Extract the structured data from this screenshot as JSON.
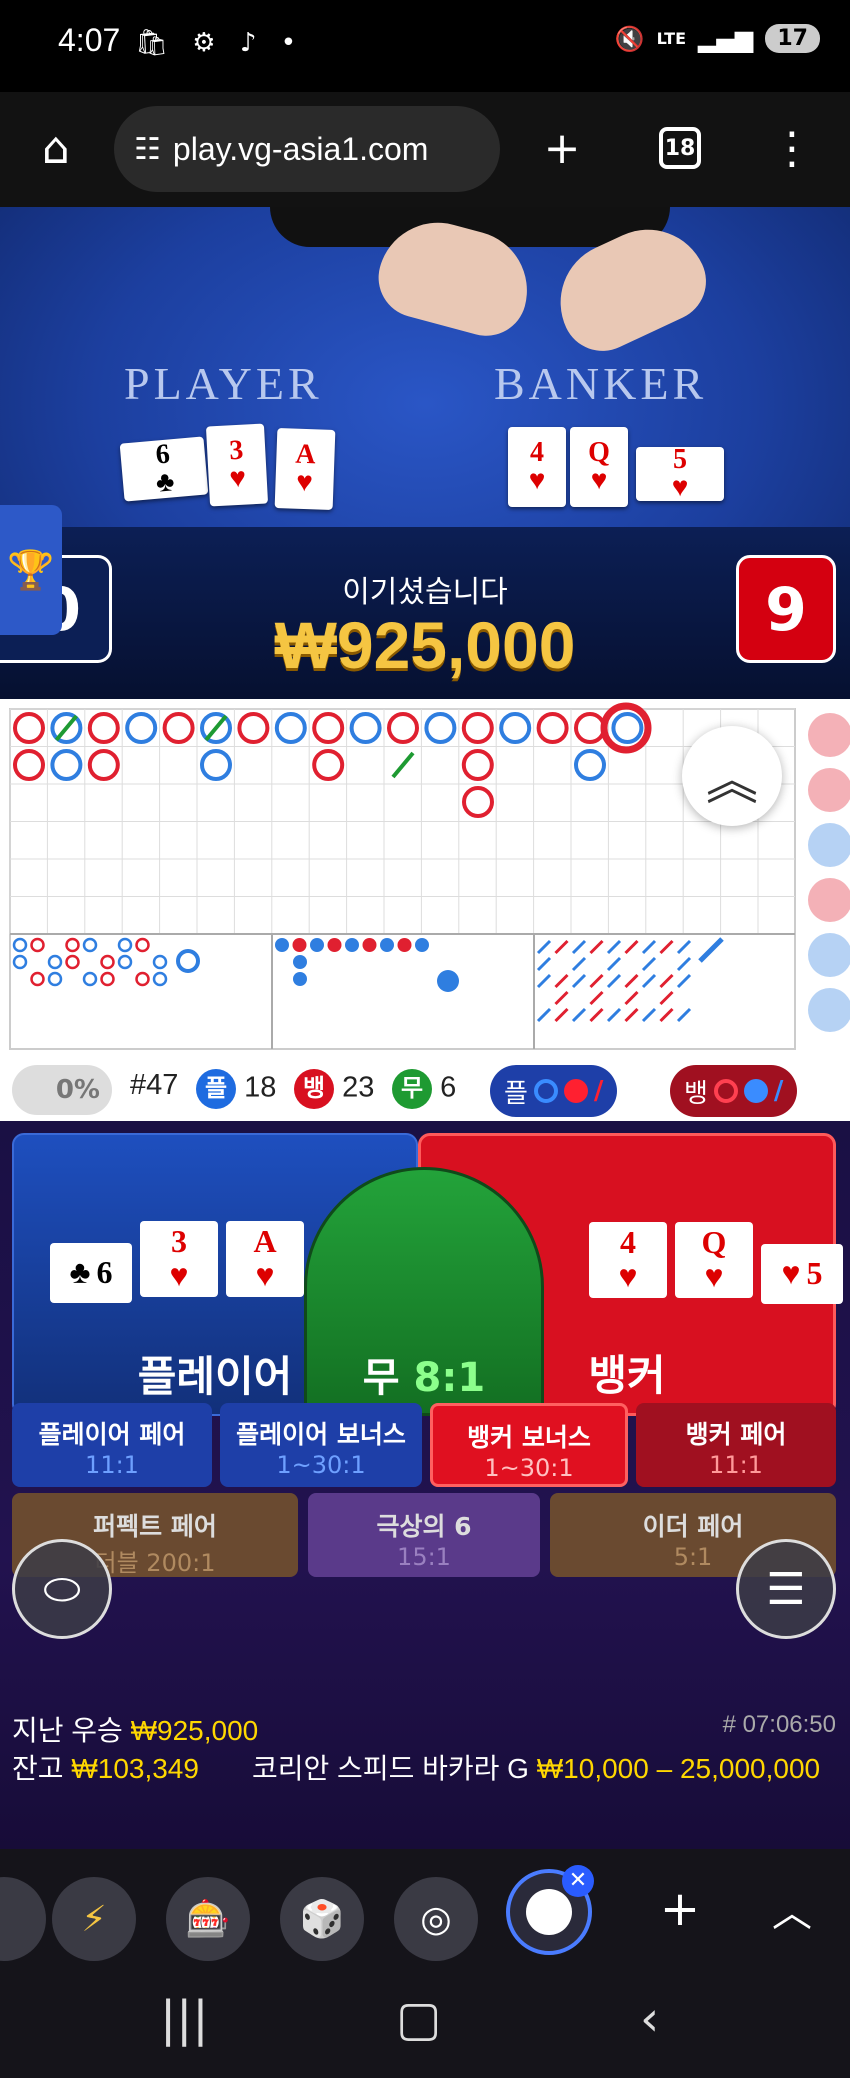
{
  "status_bar": {
    "time": "4:07",
    "battery": "17",
    "network": "LTE"
  },
  "browser": {
    "url": "play.vg-asia1.com",
    "tab_count": "18"
  },
  "video": {
    "player_label": "PLAYER",
    "banker_label": "BANKER",
    "player_cards": [
      {
        "rank": "6",
        "suit": "♣",
        "color": "black"
      },
      {
        "rank": "3",
        "suit": "♥",
        "color": "red"
      },
      {
        "rank": "A",
        "suit": "♥",
        "color": "red"
      }
    ],
    "banker_cards": [
      {
        "rank": "4",
        "suit": "♥",
        "color": "red"
      },
      {
        "rank": "Q",
        "suit": "♥",
        "color": "red"
      },
      {
        "rank": "5",
        "suit": "♥",
        "color": "red"
      }
    ],
    "win_message": "이기셨습니다",
    "win_amount": "₩925,000",
    "player_score": "0",
    "banker_score": "9"
  },
  "stats": {
    "percent": "0%",
    "round": "#47",
    "player_chip": "플",
    "player_count": "18",
    "banker_chip": "뱅",
    "banker_count": "23",
    "tie_chip": "무",
    "tie_count": "6",
    "player_predict": "플",
    "banker_predict": "뱅"
  },
  "betting": {
    "player_label": "플레이어",
    "tie_label": "무",
    "tie_odds": "8:1",
    "banker_label": "뱅커",
    "side_bets": [
      {
        "name": "플레이어 페어",
        "odds": "11:1"
      },
      {
        "name": "플레이어 보너스",
        "odds": "1~30:1"
      },
      {
        "name": "뱅커 보너스",
        "odds": "1~30:1"
      },
      {
        "name": "뱅커 페어",
        "odds": "11:1"
      }
    ],
    "side_bets_2": [
      {
        "name": "퍼펙트 페어",
        "odds": "더블 200:1"
      },
      {
        "name": "극상의 6",
        "odds": "15:1"
      },
      {
        "name": "이더 페어",
        "odds": "5:1"
      }
    ],
    "last_win_label": "지난 우승",
    "last_win_value": "₩925,000",
    "round_id": "# 07:06:50",
    "balance_label": "잔고",
    "balance_value": "₩103,349",
    "table_name": "코리안 스피드 바카라 G",
    "bet_limits": "₩10,000 – 25,000,000"
  },
  "colors": {
    "player_blue": "#1e4fbf",
    "banker_red": "#d81020",
    "tie_green": "#1e9a32",
    "gold": "#ffd700"
  }
}
